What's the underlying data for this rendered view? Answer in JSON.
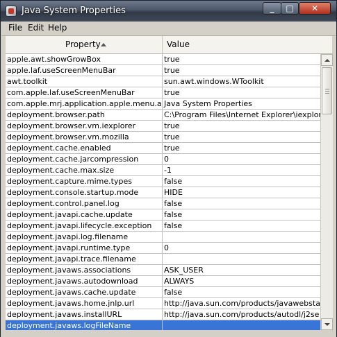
{
  "window": {
    "title": "Java System Properties"
  },
  "menu": [
    "File",
    "Edit",
    "Help"
  ],
  "table": {
    "headers": {
      "property": "Property",
      "value": "Value"
    },
    "selected_index": 24,
    "rows": [
      [
        "apple.awt.showGrowBox",
        "true"
      ],
      [
        "apple.laf.useScreenMenuBar",
        "true"
      ],
      [
        "awt.toolkit",
        "sun.awt.windows.WToolkit"
      ],
      [
        "com.apple.laf.useScreenMenuBar",
        "true"
      ],
      [
        "com.apple.mrj.application.apple.menu.abo...",
        "Java System Properties"
      ],
      [
        "deployment.browser.path",
        "C:\\Program Files\\Internet Explorer\\iexplore..."
      ],
      [
        "deployment.browser.vm.iexplorer",
        "true"
      ],
      [
        "deployment.browser.vm.mozilla",
        "true"
      ],
      [
        "deployment.cache.enabled",
        "true"
      ],
      [
        "deployment.cache.jarcompression",
        "0"
      ],
      [
        "deployment.cache.max.size",
        "-1"
      ],
      [
        "deployment.capture.mime.types",
        "false"
      ],
      [
        "deployment.console.startup.mode",
        "HIDE"
      ],
      [
        "deployment.control.panel.log",
        "false"
      ],
      [
        "deployment.javapi.cache.update",
        "false"
      ],
      [
        "deployment.javapi.lifecycle.exception",
        "false"
      ],
      [
        "deployment.javapi.log.filename",
        ""
      ],
      [
        "deployment.javapi.runtime.type",
        "0"
      ],
      [
        "deployment.javapi.trace.filename",
        ""
      ],
      [
        "deployment.javaws.associations",
        "ASK_USER"
      ],
      [
        "deployment.javaws.autodownload",
        "ALWAYS"
      ],
      [
        "deployment.javaws.cache.update",
        "false"
      ],
      [
        "deployment.javaws.home.jnlp.url",
        "http://java.sun.com/products/javawebstart"
      ],
      [
        "deployment.javaws.installURL",
        "http://java.sun.com/products/autodl/j2se"
      ],
      [
        "deployment.javaws.logFileName",
        ""
      ]
    ]
  },
  "colors": {
    "selection": "#3875d7",
    "titlebar": "#4b5668",
    "close": "#c8412a"
  },
  "icons": {
    "sort": "sort-ascending-icon",
    "scroll_up": "arrow-up-icon",
    "scroll_down": "arrow-down-icon"
  }
}
